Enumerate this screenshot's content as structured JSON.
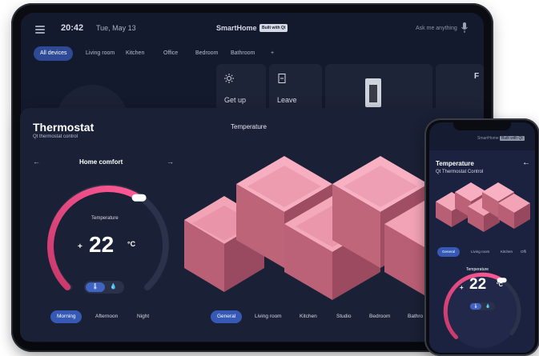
{
  "tablet": {
    "time": "20:42",
    "date": "Tue, May 13",
    "brand": "SmartHome",
    "brand_badge": "Built with Qt",
    "ask": "Ask me anything",
    "tabs": [
      "All devices",
      "Living room",
      "Kitchen",
      "Office",
      "Bedroom",
      "Bathroom",
      "+"
    ],
    "tiles": [
      {
        "label": "Get up",
        "icon": "sun-icon"
      },
      {
        "label": "Leave",
        "icon": "door-icon"
      }
    ],
    "tile_cut_letter": "F"
  },
  "panel": {
    "title": "Thermostat",
    "subtitle": "Qt thermostat control",
    "section_label": "Temperature",
    "mode": "Home comfort",
    "dial_label": "Temperature",
    "temp_sign": "+",
    "temp_value": "22",
    "temp_unit": "°C",
    "temp_fraction": 0.62,
    "modes": [
      "Morning",
      "Afternoon",
      "Night"
    ],
    "rooms": [
      "General",
      "Living room",
      "Kitchen",
      "Studio",
      "Bedroom",
      "Bathro"
    ]
  },
  "phone": {
    "brand": "SmartHome",
    "brand_badge": "Built with Qt",
    "title": "Temperature",
    "subtitle": "Qt Thermostat Control",
    "tabs": [
      "General",
      "Living room",
      "Kitchen",
      "Offi"
    ],
    "dial_label": "Temperature",
    "temp_sign": "+",
    "temp_value": "22",
    "temp_unit": "°C"
  },
  "colors": {
    "accent": "#e8457a",
    "active": "#3559b4",
    "panel": "#1a2035",
    "room": "#f4a6b8"
  }
}
